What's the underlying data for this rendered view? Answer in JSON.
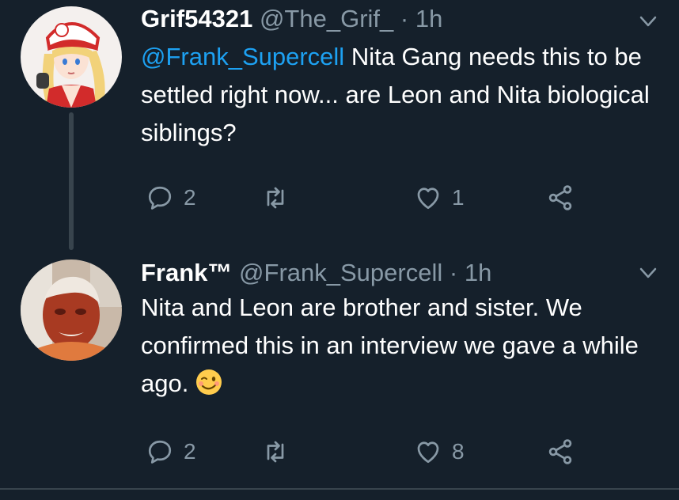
{
  "tweets": [
    {
      "display_name": "Grif54321",
      "handle": "@The_Grif_",
      "separator": "·",
      "time": "1h",
      "mention": "@Frank_Supercell",
      "text": " Nita Gang needs this to be settled right now... are Leon and Nita biological siblings?",
      "reply_count": "2",
      "retweet_count": "",
      "like_count": "1",
      "avatar_icon": "anime-character-avatar"
    },
    {
      "display_name": "Frank™",
      "handle": "@Frank_Supercell",
      "separator": "·",
      "time": "1h",
      "text": "Nita and Leon are brother and sister. We confirmed this in an interview we gave a while ago.",
      "emoji": "winking-face-emoji",
      "reply_count": "2",
      "retweet_count": "",
      "like_count": "8",
      "avatar_icon": "face-mask-photo-avatar"
    }
  ],
  "colors": {
    "background": "#15202b",
    "text": "#ffffff",
    "secondary": "#8899a6",
    "link": "#1da1f2",
    "divider": "#38444d"
  }
}
